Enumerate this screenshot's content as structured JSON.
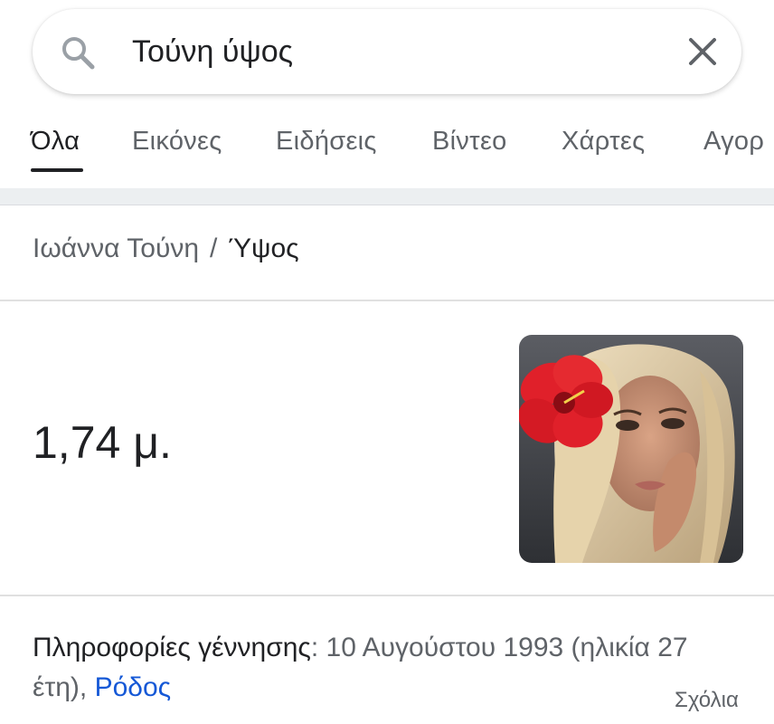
{
  "search": {
    "query": "Τούνη ύψος"
  },
  "tabs": [
    {
      "label": "Όλα"
    },
    {
      "label": "Εικόνες"
    },
    {
      "label": "Ειδήσεις"
    },
    {
      "label": "Βίντεο"
    },
    {
      "label": "Χάρτες"
    },
    {
      "label": "Αγορ"
    }
  ],
  "breadcrumb": {
    "parent": "Ιωάννα Τούνη",
    "separator": "/",
    "current": "Ύψος"
  },
  "answer": {
    "value": "1,74 μ."
  },
  "info": {
    "label": "Πληροφορίες γέννησης",
    "colon": ":",
    "date_text": " 10 Αυγούστου 1993 (ηλικία 27 έτη), ",
    "place_link": "Ρόδος"
  },
  "feedback": {
    "label": "Σχόλια"
  },
  "colors": {
    "link": "#1558d6",
    "text": "#202124",
    "muted": "#5f6368",
    "flower": "#e0202a",
    "hair": "#dcc7a0"
  },
  "icons": [
    "search-icon",
    "close-icon",
    "hibiscus-flower-icon"
  ]
}
